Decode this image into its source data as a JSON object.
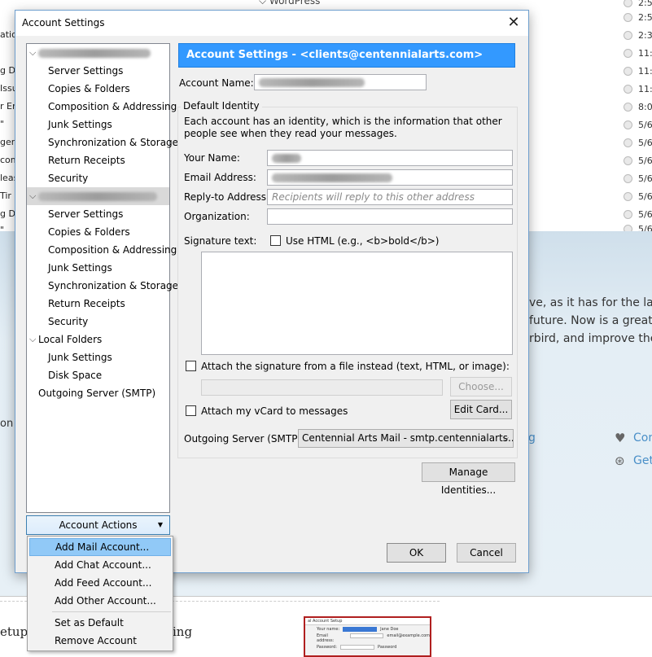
{
  "background": {
    "top_fragment": "WordPress",
    "left_fragments": [
      "atio",
      "g De",
      "Issu",
      "r Er",
      "\"",
      "ger:",
      "com",
      "leas",
      "Tir",
      "g De",
      "\""
    ],
    "times": [
      "2:5",
      "2:5",
      "2:3",
      "11:",
      "11:",
      "11:",
      "8:0",
      "5/6",
      "5/6",
      "5/6",
      "5/6",
      "5/6",
      "5/6",
      "5/6"
    ],
    "banner_lines": [
      "ve, as it has for the last",
      "future. Now is a great",
      "rbird, and improve the"
    ],
    "link_fragment": "g",
    "side_links": [
      "Con",
      "Get"
    ],
    "on_fragment": "on",
    "setup_fragment": "etup",
    "ing_fragment": "ing",
    "thumb": {
      "title": "al Account Setup",
      "rows": [
        {
          "label": "Your name:",
          "value": "Jane Doe"
        },
        {
          "label": "Email address:",
          "value": "email@example.com"
        },
        {
          "label": "Password:",
          "value": "Password"
        }
      ]
    }
  },
  "dialog": {
    "title": "Account Settings",
    "tree": {
      "account1_children": [
        "Server Settings",
        "Copies & Folders",
        "Composition & Addressing",
        "Junk Settings",
        "Synchronization & Storage",
        "Return Receipts",
        "Security"
      ],
      "account2_children": [
        "Server Settings",
        "Copies & Folders",
        "Composition & Addressing",
        "Junk Settings",
        "Synchronization & Storage",
        "Return Receipts",
        "Security"
      ],
      "local_folders": "Local Folders",
      "local_children": [
        "Junk Settings",
        "Disk Space"
      ],
      "outgoing_server": "Outgoing Server (SMTP)"
    },
    "account_actions_label": "Account Actions",
    "header": "Account Settings - <clients@centennialarts.com>",
    "account_name_label": "Account Name:",
    "default_identity_label": "Default Identity",
    "identity_desc": "Each account has an identity, which is the information that other people see when they read your messages.",
    "your_name_label": "Your Name:",
    "email_label": "Email Address:",
    "reply_to_label": "Reply-to Address:",
    "reply_to_placeholder": "Recipients will reply to this other address",
    "organization_label": "Organization:",
    "signature_label": "Signature text:",
    "use_html_label": "Use HTML (e.g., <b>bold</b>)",
    "attach_sig_label": "Attach the signature from a file instead (text, HTML, or image):",
    "choose_label": "Choose...",
    "vcard_label": "Attach my vCard to messages",
    "edit_card_label": "Edit Card...",
    "outgoing_label": "Outgoing Server (SMTP):",
    "outgoing_value": "Centennial Arts Mail - smtp.centennialarts....",
    "manage_identities_label": "Manage Identities...",
    "ok_label": "OK",
    "cancel_label": "Cancel"
  },
  "menu": {
    "items": [
      "Add Mail Account...",
      "Add Chat Account...",
      "Add Feed Account...",
      "Add Other Account..."
    ],
    "secondary": [
      "Set as Default",
      "Remove Account"
    ]
  }
}
